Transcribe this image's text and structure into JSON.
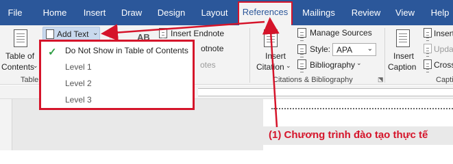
{
  "tabs": [
    "File",
    "Home",
    "Insert",
    "Draw",
    "Design",
    "Layout",
    "References",
    "Mailings",
    "Review",
    "View",
    "Help"
  ],
  "active_tab": "References",
  "ribbon": {
    "toc": {
      "line1": "Table of",
      "line2": "Contents",
      "group": "Table"
    },
    "add_text": "Add Text",
    "insert_endnote": "Insert Endnote",
    "footnote_partial": "otnote",
    "notes_partial": "otes",
    "insert_citation": {
      "line1": "Insert",
      "line2": "Citation"
    },
    "manage_sources": "Manage Sources",
    "style_label": "Style:",
    "style_value": "APA",
    "bibliography": "Bibliography",
    "citations_group": "Citations & Bibliography",
    "insert_caption": {
      "line1": "Insert",
      "line2": "Caption"
    },
    "right_items": [
      "Insert",
      "Upda",
      "Cross"
    ],
    "captions_group": "Capti"
  },
  "dropdown": {
    "items": [
      {
        "label": "Do Not Show in Table of Contents",
        "checked": true
      },
      {
        "label": "Level 1",
        "checked": false
      },
      {
        "label": "Level 2",
        "checked": false
      },
      {
        "label": "Level 3",
        "checked": false
      }
    ]
  },
  "caption": "(1) Chương trình đào tạo thực tế",
  "colors": {
    "ribbon_blue": "#2b579a",
    "annotation_red": "#d5142a",
    "check_green": "#2f9e44"
  }
}
